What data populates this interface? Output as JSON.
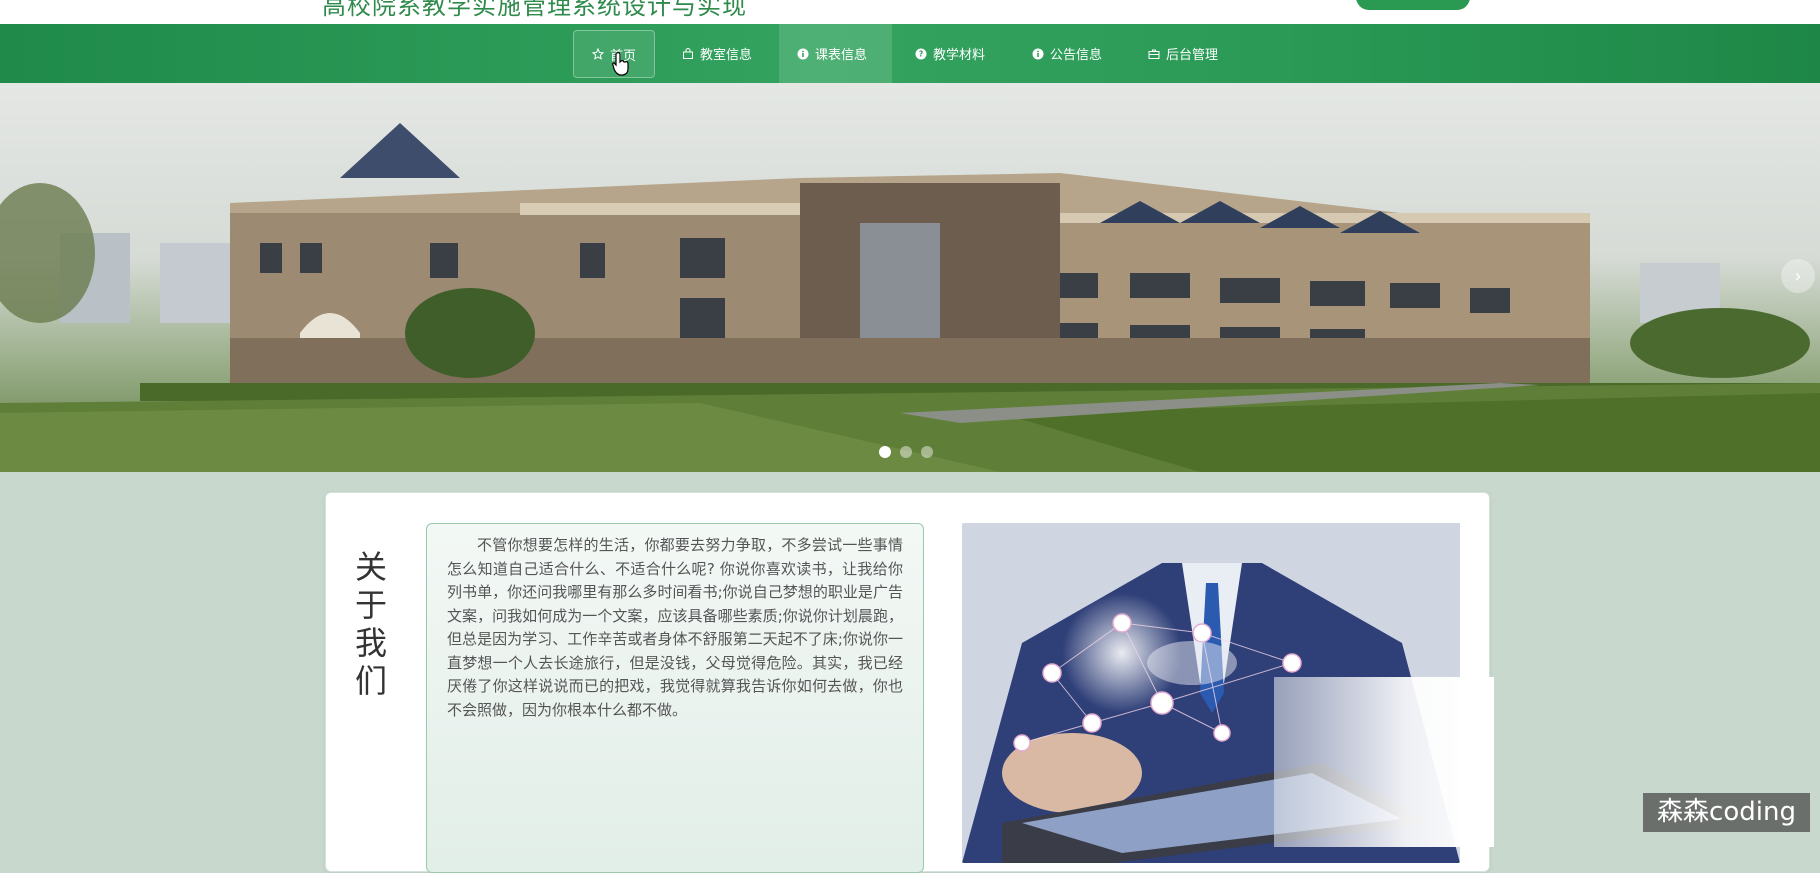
{
  "header": {
    "site_title": "高校院系教学实施管理系统设计与实现"
  },
  "nav": {
    "items": [
      {
        "label": "首页",
        "icon": "star-icon"
      },
      {
        "label": "教室信息",
        "icon": "bag-icon"
      },
      {
        "label": "课表信息",
        "icon": "info-icon"
      },
      {
        "label": "教学材料",
        "icon": "question-icon"
      },
      {
        "label": "公告信息",
        "icon": "info-icon"
      },
      {
        "label": "后台管理",
        "icon": "briefcase-icon"
      }
    ],
    "active_index": 2
  },
  "banner": {
    "next_arrow": "›",
    "slide_count": 3,
    "current_slide": 1
  },
  "about": {
    "title": "关于我们",
    "text": "不管你想要怎样的生活，你都要去努力争取，不多尝试一些事情怎么知道自己适合什么、不适合什么呢? 你说你喜欢读书，让我给你列书单，你还问我哪里有那么多时间看书;你说自己梦想的职业是广告文案，问我如何成为一个文案，应该具备哪些素质;你说你计划晨跑，但总是因为学习、工作辛苦或者身体不舒服第二天起不了床;你说你一直梦想一个人去长途旅行，但是没钱，父母觉得危险。其实，我已经厌倦了你这样说说而已的把戏，我觉得就算我告诉你如何去做，你也不会照做，因为你根本什么都不做。"
  },
  "watermark": {
    "text": "森森coding"
  },
  "colors": {
    "nav_green": "#2a9a56",
    "title_green": "#2f8a4c",
    "page_bg": "#c9d8cd"
  }
}
